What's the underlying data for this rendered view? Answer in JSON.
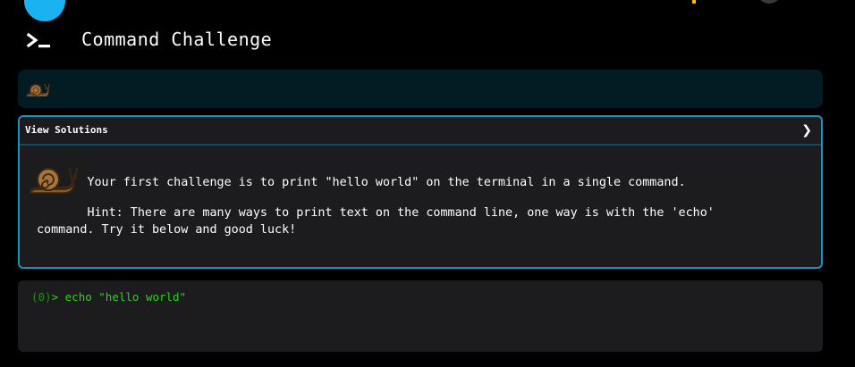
{
  "header": {
    "title": "Command Challenge",
    "icon": "terminal-icon"
  },
  "status_bar": {
    "icon": "snail-icon"
  },
  "panel": {
    "solutions_label": "View Solutions",
    "chevron": "❯",
    "message_1": "       Your first challenge is to print \"hello world\" on the terminal in a single command.",
    "message_2": "       Hint: There are many ways to print text on the command line, one way is with the 'echo'\ncommand. Try it below and good luck!",
    "icon": "snail-icon"
  },
  "terminal": {
    "exit_code": "(0)",
    "prompt": "> ",
    "command": "echo \"hello world\""
  },
  "colors": {
    "background": "#000000",
    "accent_blue": "#1ab2f0",
    "panel_border": "#1e8fbf",
    "terminal_green": "#2fd11b",
    "snail_brown": "#8a5a2b"
  }
}
